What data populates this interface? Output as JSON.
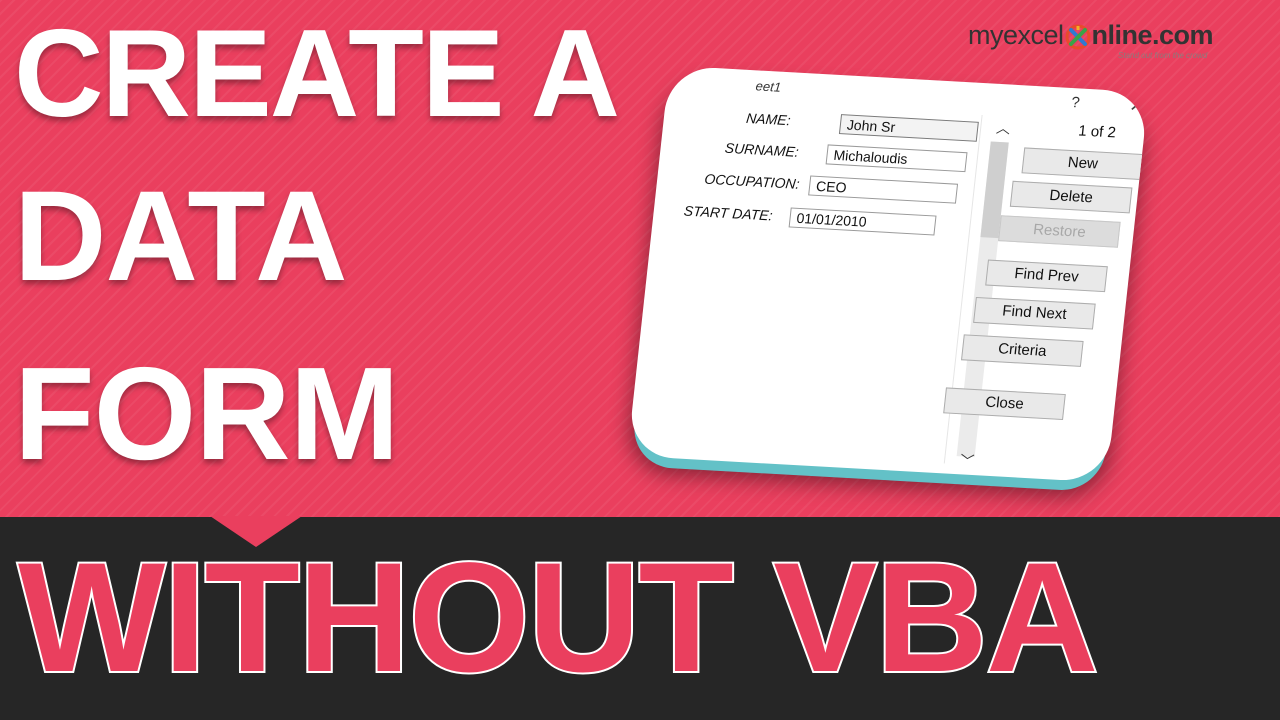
{
  "headline": {
    "line1": "CREATE A",
    "line2": "DATA",
    "line3": "FORM"
  },
  "subheadline": "WITHOUT VBA",
  "brand": {
    "prefix": "myexcel",
    "suffix": "nline.com",
    "tagline": "Stand out from the crowd"
  },
  "dialog": {
    "title": "eet1",
    "help": "?",
    "close_glyph": "✕",
    "record_count": "1 of 2",
    "fields": [
      {
        "label": "NAME:",
        "value": "John Sr"
      },
      {
        "label": "SURNAME:",
        "value": "Michaloudis"
      },
      {
        "label": "OCCUPATION:",
        "value": "CEO"
      },
      {
        "label": "START DATE:",
        "value": "01/01/2010"
      }
    ],
    "buttons": {
      "new": "New",
      "delete": "Delete",
      "restore": "Restore",
      "find_prev": "Find Prev",
      "find_next": "Find Next",
      "criteria": "Criteria",
      "close": "Close"
    },
    "scroll_up_glyph": "︿",
    "scroll_down_glyph": "﹀"
  },
  "colors": {
    "accent": "#ea3f5e",
    "dark_band": "#262626",
    "dialog_edge": "#63c1c7"
  }
}
